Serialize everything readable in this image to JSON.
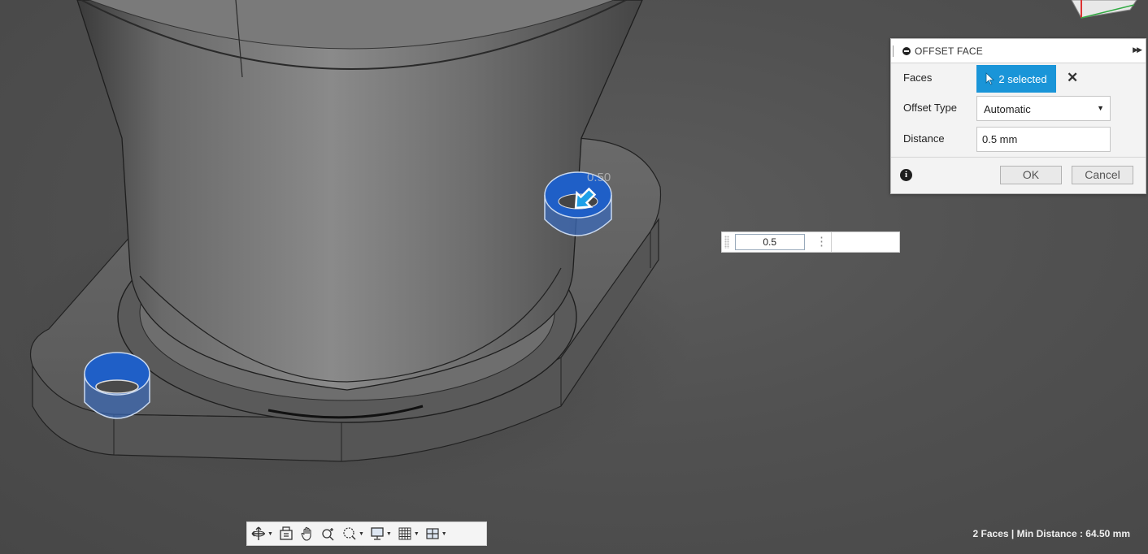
{
  "dialog": {
    "title": "OFFSET FACE",
    "faces_label": "Faces",
    "faces_selection": "2 selected",
    "offset_type_label": "Offset Type",
    "offset_type_value": "Automatic",
    "distance_label": "Distance",
    "distance_value": "0.5 mm",
    "ok_label": "OK",
    "cancel_label": "Cancel"
  },
  "floating_input": {
    "value": "0.5"
  },
  "viewport": {
    "dimension_label": "0.50"
  },
  "status": {
    "text": "2 Faces | Min Distance : 64.50 mm"
  },
  "toolbar": {
    "items": [
      "orbit-icon",
      "look-at-icon",
      "pan-icon",
      "zoom-icon",
      "fit-icon",
      "display-settings-icon",
      "grid-icon",
      "viewports-icon"
    ]
  },
  "colors": {
    "selection_blue": "#1a95d8",
    "face_highlight": "#2a62b8",
    "background": "#505050"
  }
}
